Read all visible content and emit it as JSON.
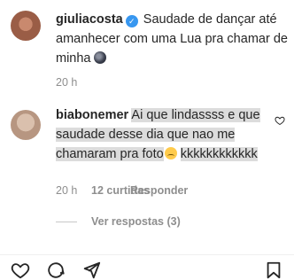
{
  "post": {
    "username": "giuliacosta",
    "caption": "Saudade de dançar até amanhecer com uma Lua pra chamar de minha",
    "time": "20 h"
  },
  "comment": {
    "username": "biabonemer",
    "text": "Ai que lindassss e que saudade desse dia que nao me chamaram pra foto",
    "text_end": "kkkkkkkkkkkk",
    "time": "20 h",
    "likes": "12 curtidas",
    "reply": "Responder"
  },
  "replies": {
    "label": "Ver respostas (3)"
  },
  "icons": {
    "verified": "verified-badge-icon",
    "moon": "new-moon-emoji-icon",
    "sad": "pensive-face-emoji-icon",
    "like": "heart-outline-icon"
  },
  "colors": {
    "text": "#262626",
    "secondary": "#8e8e8e",
    "verified": "#3897f0",
    "highlight": "#dcdcdc"
  }
}
